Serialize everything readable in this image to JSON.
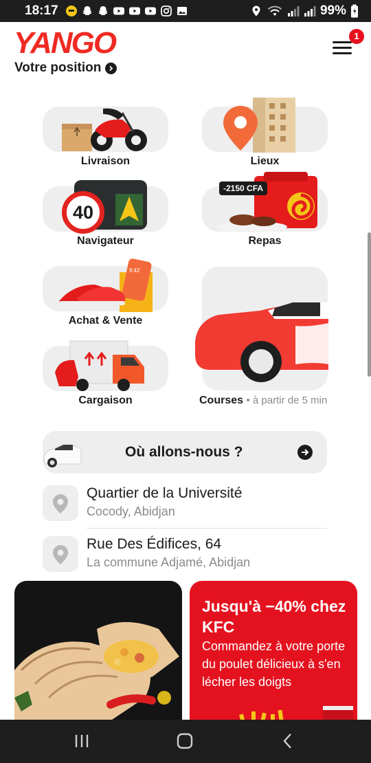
{
  "status_bar": {
    "time": "18:17",
    "battery": "99%",
    "left_icons": [
      "emoji-notification-icon",
      "snapchat-icon",
      "snapchat-icon",
      "youtube-icon",
      "youtube-icon",
      "youtube-icon",
      "instagram-icon",
      "gallery-icon"
    ],
    "right_icons": [
      "location-icon",
      "wifi-icon",
      "signal-icon",
      "signal-icon",
      "battery-icon"
    ]
  },
  "header": {
    "logo": "YANGO",
    "position_label": "Votre position",
    "menu_badge": "1"
  },
  "services": {
    "livraison": "Livraison",
    "lieux": "Lieux",
    "navigateur": "Navigateur",
    "navigateur_speed": "40",
    "repas": "Repas",
    "repas_price_tag": "-2150 CFA",
    "achat_vente": "Achat & Vente",
    "phone_time": "9:42",
    "cargaison": "Cargaison",
    "courses": "Courses",
    "courses_sub": "• à partir de 5 min"
  },
  "search": {
    "prompt": "Où allons-nous ?"
  },
  "addresses": [
    {
      "title": "Quartier de la Université",
      "subtitle": "Cocody, Abidjan"
    },
    {
      "title": "Rue Des Édifices, 64",
      "subtitle": "La commune Adjamé, Abidjan"
    }
  ],
  "promos": {
    "kfc_title": "Jusqu'à −40% chez KFC",
    "kfc_body": "Commandez à votre porte du poulet délicieux à s'en lécher les doigts"
  },
  "colors": {
    "brand_red": "#ef2a23",
    "tile_bg": "#eeeeee",
    "promo_red": "#e4121f",
    "system_bar": "#1e1e1e"
  }
}
